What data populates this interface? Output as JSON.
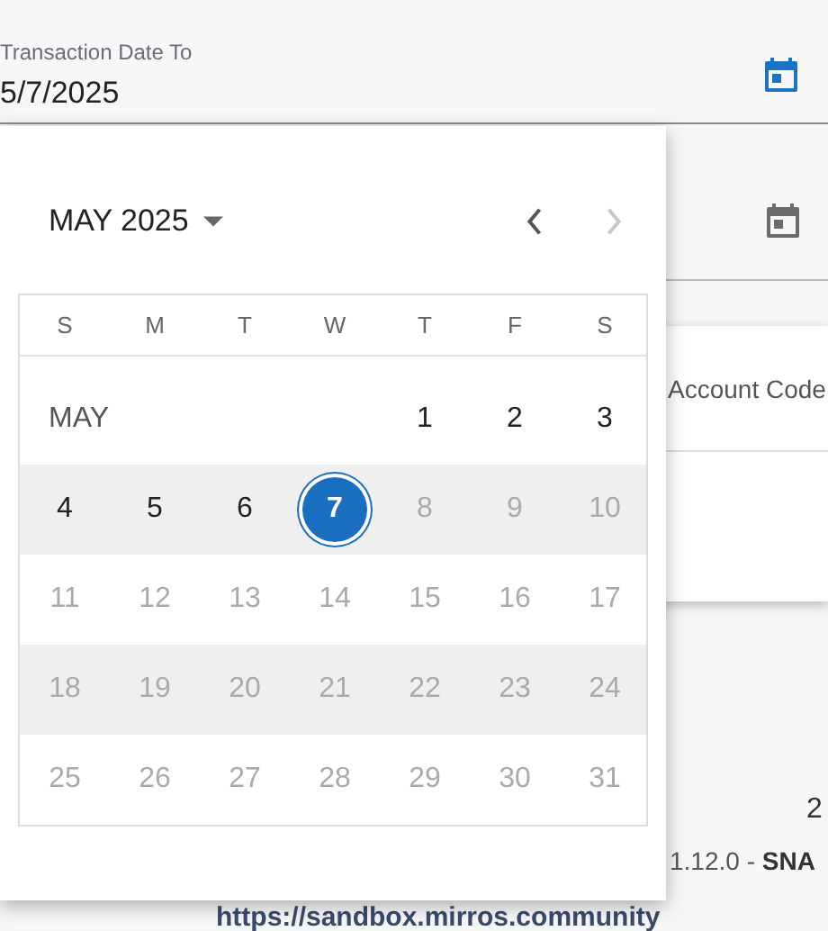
{
  "date_field": {
    "label": "Transaction Date To",
    "value": "5/7/2025"
  },
  "account_card": {
    "label": "Account Code"
  },
  "footer": {
    "year_fragment": "2",
    "version": "1.12.0 - **SNA**",
    "link": "https://sandbox.mirros.community"
  },
  "calendar": {
    "month_year": "MAY 2025",
    "prev_disabled": false,
    "next_disabled": true,
    "weekdays": [
      "S",
      "M",
      "T",
      "W",
      "T",
      "F",
      "S"
    ],
    "month_label": "MAY",
    "weeks": [
      [
        {
          "label": "1",
          "selected": false,
          "disabled": false
        },
        {
          "label": "2",
          "selected": false,
          "disabled": false
        },
        {
          "label": "3",
          "selected": false,
          "disabled": false
        }
      ],
      [
        {
          "label": "4",
          "selected": false,
          "disabled": false
        },
        {
          "label": "5",
          "selected": false,
          "disabled": false
        },
        {
          "label": "6",
          "selected": false,
          "disabled": false
        },
        {
          "label": "7",
          "selected": true,
          "disabled": false
        },
        {
          "label": "8",
          "selected": false,
          "disabled": true
        },
        {
          "label": "9",
          "selected": false,
          "disabled": true
        },
        {
          "label": "10",
          "selected": false,
          "disabled": true
        }
      ],
      [
        {
          "label": "11",
          "selected": false,
          "disabled": true
        },
        {
          "label": "12",
          "selected": false,
          "disabled": true
        },
        {
          "label": "13",
          "selected": false,
          "disabled": true
        },
        {
          "label": "14",
          "selected": false,
          "disabled": true
        },
        {
          "label": "15",
          "selected": false,
          "disabled": true
        },
        {
          "label": "16",
          "selected": false,
          "disabled": true
        },
        {
          "label": "17",
          "selected": false,
          "disabled": true
        }
      ],
      [
        {
          "label": "18",
          "selected": false,
          "disabled": true
        },
        {
          "label": "19",
          "selected": false,
          "disabled": true
        },
        {
          "label": "20",
          "selected": false,
          "disabled": true
        },
        {
          "label": "21",
          "selected": false,
          "disabled": true
        },
        {
          "label": "22",
          "selected": false,
          "disabled": true
        },
        {
          "label": "23",
          "selected": false,
          "disabled": true
        },
        {
          "label": "24",
          "selected": false,
          "disabled": true
        }
      ],
      [
        {
          "label": "25",
          "selected": false,
          "disabled": true
        },
        {
          "label": "26",
          "selected": false,
          "disabled": true
        },
        {
          "label": "27",
          "selected": false,
          "disabled": true
        },
        {
          "label": "28",
          "selected": false,
          "disabled": true
        },
        {
          "label": "29",
          "selected": false,
          "disabled": true
        },
        {
          "label": "30",
          "selected": false,
          "disabled": true
        },
        {
          "label": "31",
          "selected": false,
          "disabled": true
        }
      ]
    ]
  }
}
